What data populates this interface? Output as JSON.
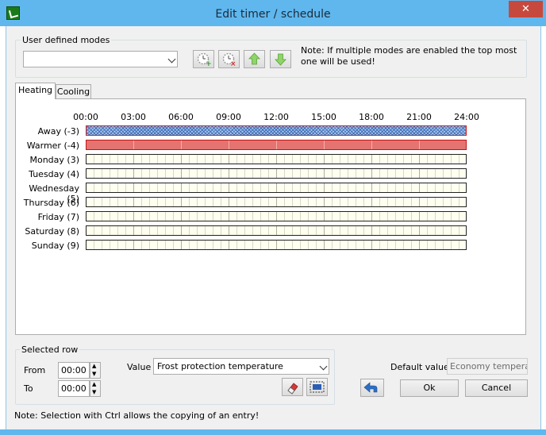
{
  "window": {
    "title": "Edit timer / schedule",
    "close_glyph": "✕"
  },
  "modes": {
    "group_label": "User defined modes",
    "selected": "",
    "note": "Note: If multiple modes are enabled the top most one will be used!"
  },
  "tabs": [
    "Heating",
    "Cooling"
  ],
  "schedule": {
    "hours": [
      "00:00",
      "03:00",
      "06:00",
      "09:00",
      "12:00",
      "15:00",
      "18:00",
      "21:00",
      "24:00"
    ],
    "rows": [
      {
        "label": "Away (-3)",
        "kind": "away"
      },
      {
        "label": "Warmer (-4)",
        "kind": "warmer"
      },
      {
        "label": "Monday (3)",
        "kind": "day"
      },
      {
        "label": "Tuesday (4)",
        "kind": "day"
      },
      {
        "label": "Wednesday (5)",
        "kind": "day"
      },
      {
        "label": "Thursday (6)",
        "kind": "day"
      },
      {
        "label": "Friday (7)",
        "kind": "day"
      },
      {
        "label": "Saturday (8)",
        "kind": "day"
      },
      {
        "label": "Sunday (9)",
        "kind": "day"
      }
    ]
  },
  "selected_row": {
    "group_label": "Selected row",
    "from_label": "From",
    "from_value": "00:00",
    "to_label": "To",
    "to_value": "00:00",
    "value_label": "Value",
    "value_selected": "Frost protection temperature"
  },
  "default": {
    "label": "Default value",
    "value": "Economy temperatu"
  },
  "buttons": {
    "ok": "Ok",
    "cancel": "Cancel"
  },
  "footer_note": "Note: Selection with Ctrl allows the copying of an entry!",
  "colors": {
    "titlebar": "#5fb7ee",
    "away": "#a9c7ec",
    "warmer": "#e57370",
    "close": "#c7493d"
  }
}
